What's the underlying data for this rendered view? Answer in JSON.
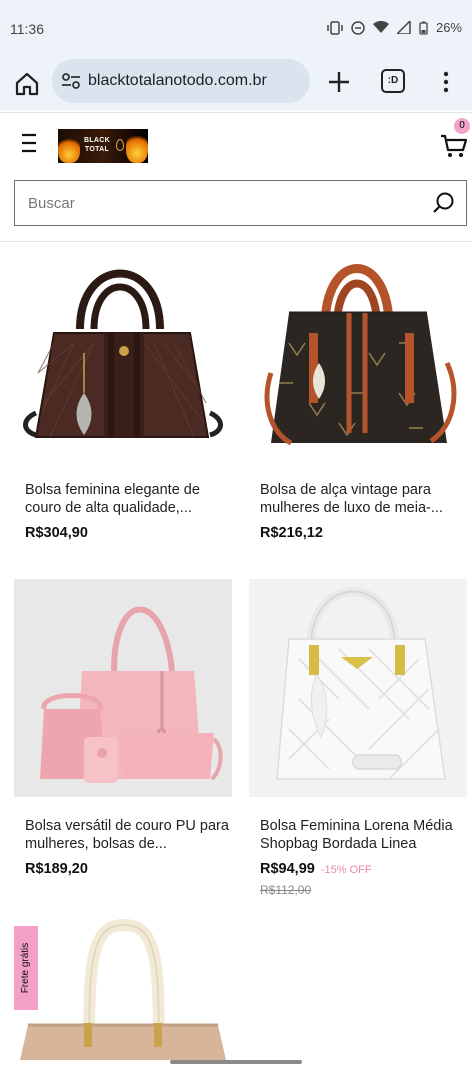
{
  "status_bar": {
    "time": "11:36",
    "battery": "26%"
  },
  "browser": {
    "url": "blacktotalanotodo.com.br",
    "tabs_label": ":D",
    "icons": [
      "home-icon",
      "site-settings-icon",
      "plus-icon",
      "tabs-icon",
      "more-vert-icon"
    ]
  },
  "header": {
    "logo_line1": "BLACK",
    "logo_line2": "TOTAL",
    "cart_count": "0",
    "cart_badge_color": "#f3a3c8",
    "search_placeholder": "Buscar"
  },
  "products": [
    {
      "title": "Bolsa feminina elegante de couro de alta qualidade,...",
      "price": "R$304,90",
      "discount": "",
      "old_price": ""
    },
    {
      "title": "Bolsa de alça vintage para mulheres de luxo de meia-...",
      "price": "R$216,12",
      "discount": "",
      "old_price": ""
    },
    {
      "title": "Bolsa versátil de couro PU para mulheres, bolsas de...",
      "price": "R$189,20",
      "discount": "",
      "old_price": ""
    },
    {
      "title": "Bolsa Feminina Lorena Média Shopbag Bordada Linea",
      "price": "R$94,99",
      "discount": "-15% OFF",
      "old_price": "R$112,00"
    }
  ],
  "badges": {
    "frete": "Frete grátis",
    "frete_color": "#f2a0c6"
  }
}
